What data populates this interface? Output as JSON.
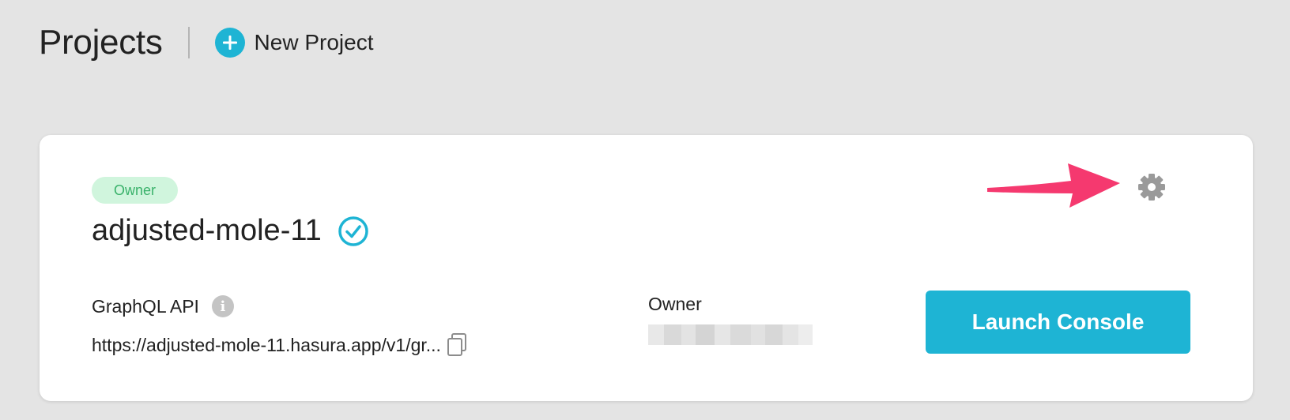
{
  "header": {
    "title": "Projects",
    "new_project_label": "New Project"
  },
  "project_card": {
    "role_badge": "Owner",
    "project_name": "adjusted-mole-11",
    "api": {
      "label": "GraphQL API",
      "url": "https://adjusted-mole-11.hasura.app/v1/gr..."
    },
    "owner": {
      "label": "Owner"
    },
    "launch_button_label": "Launch Console"
  },
  "colors": {
    "accent": "#1eb4d4",
    "badge_bg": "#d0f5dd",
    "badge_text": "#3ab26b",
    "annotation_arrow": "#f5396f",
    "page_bg": "#e4e4e4"
  },
  "icons": [
    "plus-icon",
    "verified-check-icon",
    "info-icon",
    "copy-icon",
    "gear-icon"
  ]
}
